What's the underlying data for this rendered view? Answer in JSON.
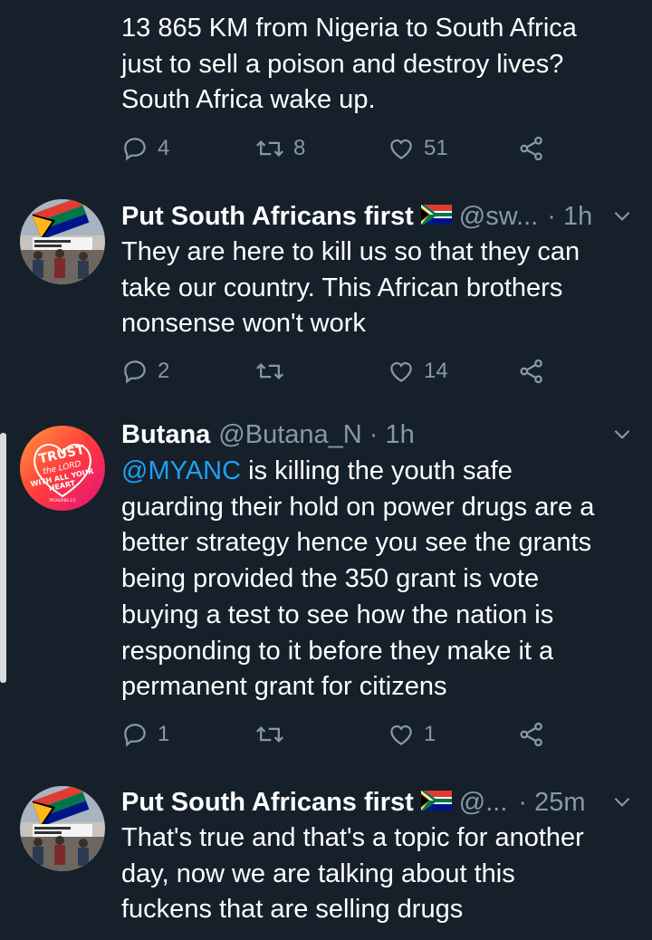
{
  "tweets": [
    {
      "body_lines": [
        "13 865 KM from Nigeria to South Africa",
        "just to sell a poison and destroy lives?",
        "South Africa wake up."
      ],
      "reply_count": "4",
      "retweet_count": "8",
      "like_count": "51"
    },
    {
      "name": "Put South Africans first",
      "handle": "@sw...",
      "time": "· 1h",
      "body_lines": [
        "They are here to kill us so that they can",
        "take our country. This African brothers",
        "nonsense won't work"
      ],
      "reply_count": "2",
      "retweet_count": "",
      "like_count": "14"
    },
    {
      "name": "Butana",
      "handle": "@Butana_N",
      "time": "· 1h",
      "mention": "@MYANC",
      "body_first_rest": " is killing the youth safe",
      "body_lines": [
        "guarding their hold on power drugs are a",
        "better strategy hence you see the grants",
        "being provided the 350 grant is vote",
        "buying a test to see how the nation is",
        "responding to it before they make it a",
        "permanent grant for citizens"
      ],
      "reply_count": "1",
      "retweet_count": "",
      "like_count": "1",
      "avatar_text": "TRUST THE LORD WITH ALL YOUR HEART",
      "avatar_caption": "PROVERBS 3:5"
    },
    {
      "name": "Put South Africans first",
      "handle": "@...",
      "time": "· 25m",
      "body_lines": [
        "That's true and that's a topic for another",
        "day, now we are talking about this",
        "fuckens that are selling drugs"
      ]
    }
  ],
  "colors": {
    "background": "#15202b",
    "text": "#ffffff",
    "secondary": "#8899a6",
    "link": "#1da1f2"
  },
  "icons": [
    "reply-icon",
    "retweet-icon",
    "like-icon",
    "share-icon",
    "chevron-down-icon",
    "south-africa-flag-icon"
  ]
}
